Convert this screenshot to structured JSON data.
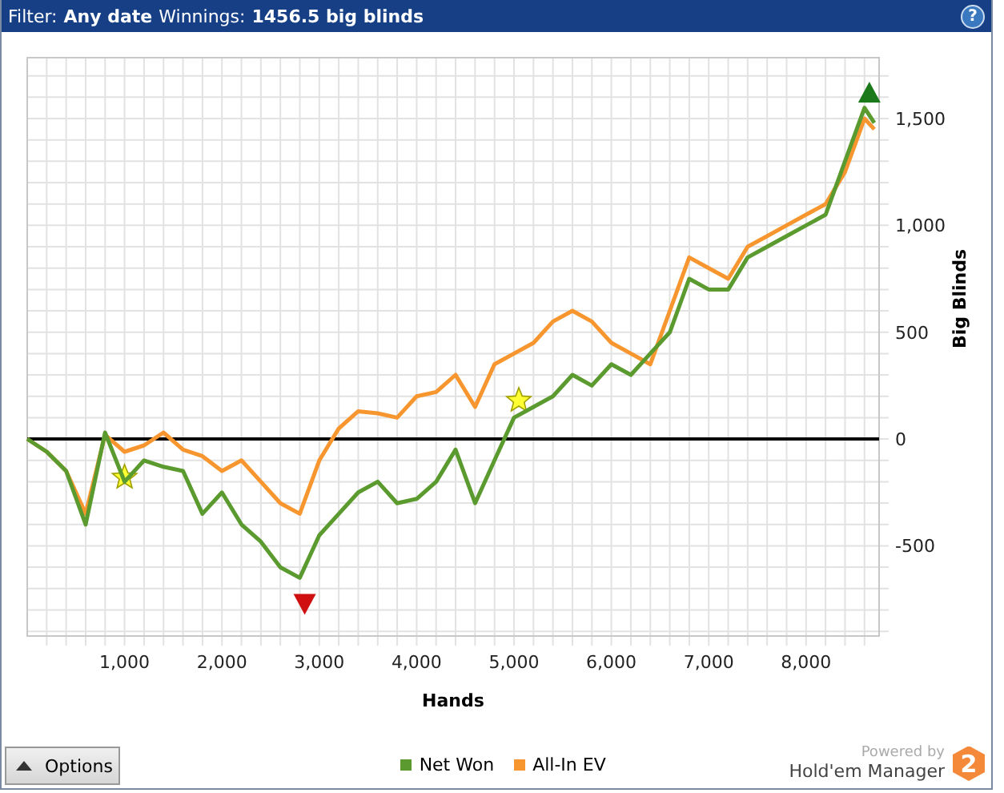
{
  "header": {
    "filter_label": "Filter:",
    "filter_value": "Any date",
    "winnings_label": "Winnings:",
    "winnings_value": "1456.5 big blinds",
    "help": "?"
  },
  "chart": {
    "chart_data": {
      "type": "line",
      "xlabel": "Hands",
      "ylabel": "Big Blinds",
      "xlim": [
        0,
        8750
      ],
      "ylim": [
        -922,
        1785
      ],
      "xticks": [
        {
          "value": 1000,
          "label": "1,000"
        },
        {
          "value": 2000,
          "label": "2,000"
        },
        {
          "value": 3000,
          "label": "3,000"
        },
        {
          "value": 4000,
          "label": "4,000"
        },
        {
          "value": 5000,
          "label": "5,000"
        },
        {
          "value": 6000,
          "label": "6,000"
        },
        {
          "value": 7000,
          "label": "7,000"
        },
        {
          "value": 8000,
          "label": "8,000"
        }
      ],
      "yticks": [
        {
          "value": -500,
          "label": "-500"
        },
        {
          "value": 0,
          "label": "0"
        },
        {
          "value": 500,
          "label": "500"
        },
        {
          "value": 1000,
          "label": "1,000"
        },
        {
          "value": 1500,
          "label": "1,500"
        }
      ],
      "x": [
        0,
        200,
        400,
        600,
        800,
        1000,
        1200,
        1400,
        1600,
        1800,
        2000,
        2200,
        2400,
        2600,
        2800,
        3000,
        3200,
        3400,
        3600,
        3800,
        4000,
        4200,
        4400,
        4600,
        4800,
        5000,
        5200,
        5400,
        5600,
        5800,
        6000,
        6200,
        6400,
        6600,
        6800,
        7000,
        7200,
        7400,
        7600,
        7800,
        8000,
        8200,
        8400,
        8600,
        8700
      ],
      "series": [
        {
          "name": "Net Won",
          "color": "#5a9a2e",
          "values": [
            0,
            -60,
            -150,
            -400,
            30,
            -200,
            -100,
            -130,
            -150,
            -350,
            -250,
            -400,
            -480,
            -600,
            -650,
            -450,
            -350,
            -250,
            -200,
            -300,
            -280,
            -200,
            -50,
            -300,
            -100,
            100,
            150,
            200,
            300,
            250,
            350,
            300,
            400,
            500,
            750,
            700,
            700,
            850,
            900,
            950,
            1000,
            1050,
            1300,
            1550,
            1480
          ]
        },
        {
          "name": "All-In EV",
          "color": "#f7962e",
          "values": [
            0,
            -60,
            -150,
            -350,
            20,
            -60,
            -30,
            30,
            -50,
            -80,
            -150,
            -100,
            -200,
            -300,
            -350,
            -100,
            50,
            130,
            120,
            100,
            200,
            220,
            300,
            150,
            350,
            400,
            450,
            550,
            600,
            550,
            450,
            400,
            350,
            600,
            850,
            800,
            750,
            900,
            950,
            1000,
            1050,
            1100,
            1250,
            1500,
            1450
          ]
        }
      ],
      "grid": true
    },
    "markers": [
      {
        "kind": "star"
      },
      {
        "kind": "star"
      },
      {
        "kind": "down"
      },
      {
        "kind": "up"
      }
    ]
  },
  "footer": {
    "options_button": "Options",
    "powered_by": "Powered by",
    "brand": "Hold'em Manager",
    "logo_text": "2"
  }
}
